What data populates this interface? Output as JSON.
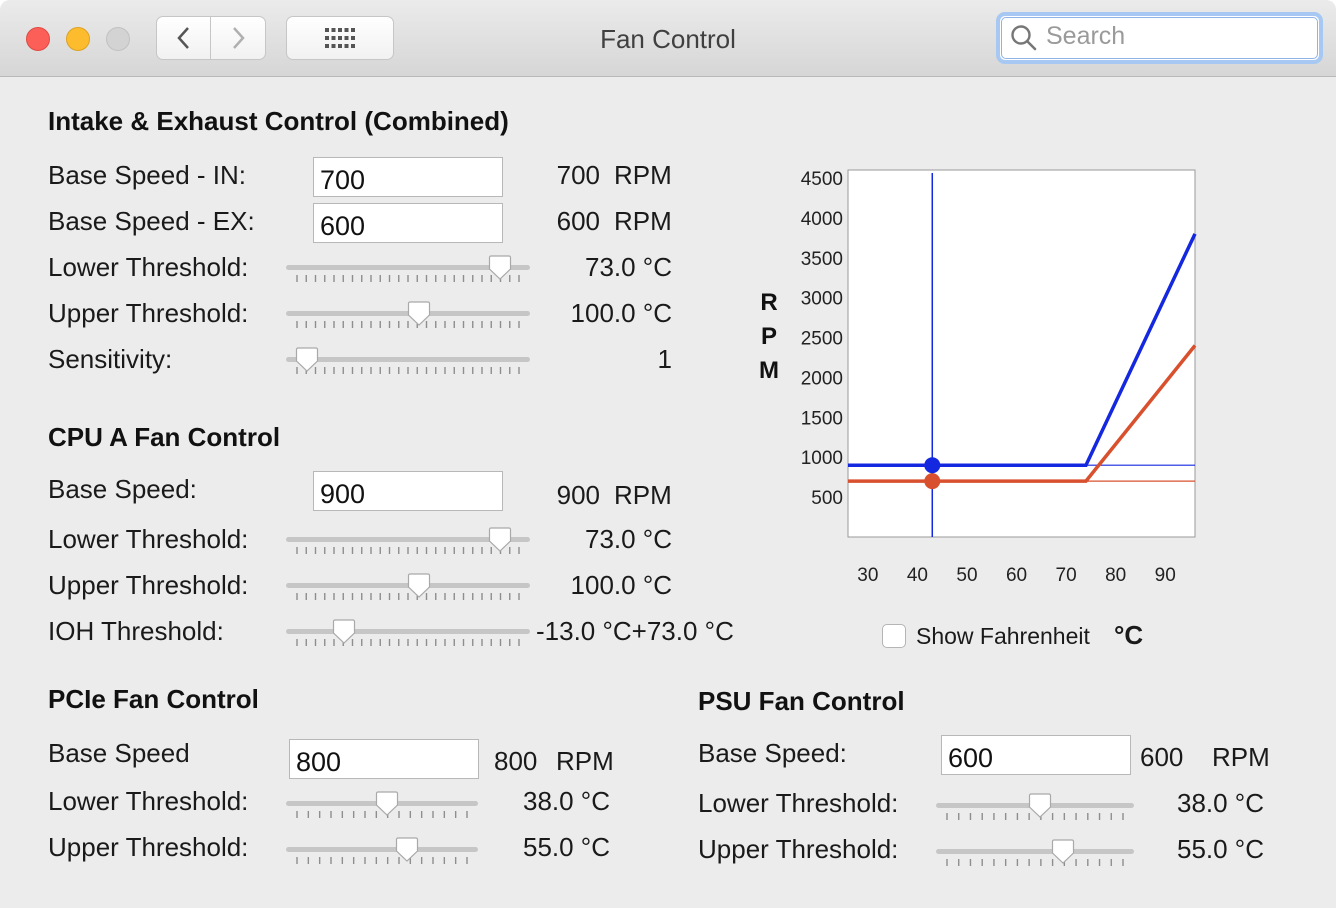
{
  "window": {
    "title": "Fan Control"
  },
  "search": {
    "placeholder": "Search"
  },
  "sections": {
    "combined": {
      "title": "Intake & Exhaust Control (Combined)",
      "base_in": {
        "label": "Base Speed - IN:",
        "input": "700",
        "value": "700",
        "unit": "RPM"
      },
      "base_ex": {
        "label": "Base Speed - EX:",
        "input": "600",
        "value": "600",
        "unit": "RPM"
      },
      "lower": {
        "label": "Lower Threshold:",
        "value": "73.0 °C",
        "level": 0.92
      },
      "upper": {
        "label": "Upper Threshold:",
        "value": "100.0 °C",
        "level": 0.55
      },
      "sensitivity": {
        "label": "Sensitivity:",
        "value": "1",
        "level": 0.04
      }
    },
    "cpu": {
      "title": "CPU A Fan Control",
      "base": {
        "label": "Base Speed:",
        "input": "900",
        "value": "900",
        "unit": "RPM"
      },
      "lower": {
        "label": "Lower Threshold:",
        "value": "73.0 °C",
        "level": 0.92
      },
      "upper": {
        "label": "Upper Threshold:",
        "value": "100.0 °C",
        "level": 0.55
      },
      "ioh": {
        "label": "IOH Threshold:",
        "value": "-13.0 °C+73.0 °C",
        "level": 0.21
      }
    },
    "pcie": {
      "title": "PCIe Fan Control",
      "base": {
        "label": "Base Speed",
        "input": "800",
        "value": "800",
        "unit": "RPM"
      },
      "lower": {
        "label": "Lower Threshold:",
        "value": "38.0 °C",
        "level": 0.53
      },
      "upper": {
        "label": "Upper Threshold:",
        "value": "55.0 °C",
        "level": 0.65
      }
    },
    "psu": {
      "title": "PSU Fan Control",
      "base": {
        "label": "Base Speed:",
        "input": "600",
        "value": "600",
        "unit": "RPM"
      },
      "lower": {
        "label": "Lower Threshold:",
        "value": "38.0 °C",
        "level": 0.53
      },
      "upper": {
        "label": "Upper Threshold:",
        "value": "55.0 °C",
        "level": 0.66
      }
    }
  },
  "chart": {
    "ylabel": "R P M",
    "y_ticks": [
      "4500",
      "4000",
      "3500",
      "3000",
      "2500",
      "2000",
      "1500",
      "1000",
      "500"
    ],
    "x_ticks": [
      "30",
      "40",
      "50",
      "60",
      "70",
      "80",
      "90"
    ],
    "show_fahrenheit": "Show Fahrenheit",
    "unit": "°C"
  },
  "chart_data": {
    "type": "line",
    "xlabel": "",
    "ylabel": "RPM",
    "xlim": [
      26,
      96
    ],
    "ylim": [
      0,
      4600
    ],
    "current_temp": 43,
    "series": [
      {
        "color": "#1428e0",
        "x": [
          26,
          74,
          96
        ],
        "y": [
          900,
          900,
          3800
        ]
      },
      {
        "color": "#d9502e",
        "x": [
          26,
          74,
          96
        ],
        "y": [
          700,
          700,
          2400
        ]
      }
    ]
  },
  "colors": {
    "blue_line": "#1428e0",
    "orange_line": "#d9502e",
    "background": "#ececec"
  }
}
